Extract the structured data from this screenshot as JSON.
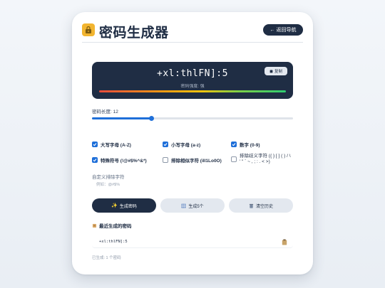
{
  "app": {
    "title": "密码生成器",
    "back_label": "返回导航"
  },
  "display": {
    "password": "+xl:thlFN]:5",
    "strength_label": "密码强度: 强",
    "copy_label": "复制"
  },
  "length": {
    "label": "密码长度: 12",
    "value": 12,
    "min": 4,
    "max": 64
  },
  "options": [
    {
      "label": "大写字母 (A-Z)",
      "checked": true
    },
    {
      "label": "小写字母 (a-z)",
      "checked": true
    },
    {
      "label": "数字 (0-9)",
      "checked": true
    },
    {
      "label": "特殊符号 (!@#$%^&*)",
      "checked": true
    },
    {
      "label": "排除相似字符 (iIl1Lo0O)",
      "checked": false
    },
    {
      "label_line1": "排除歧义字符 ({ } [ ] ( ) / \\",
      "label_line2": "' \" ` ~ , ; : . < >)",
      "checked": false
    }
  ],
  "custom": {
    "label": "自定义排除字符",
    "placeholder": "例如：@#$%"
  },
  "buttons": {
    "generate": "生成密码",
    "generate_five": "生成5个",
    "clear_history": "清空历史"
  },
  "recent": {
    "title": "最近生成的密码",
    "items": [
      "+xl:thlFN]:5"
    ],
    "count_text": "已生成: 1 个密码"
  },
  "colors": {
    "primary": "#1f2d44",
    "accent": "#1e6fd9",
    "secondary_bg": "#e3e8ef",
    "logo": "#f2b530"
  },
  "icons": {
    "logo": "lock-icon",
    "back": "arrow-left-icon",
    "copy": "clipboard-icon",
    "generate": "sparkles-icon",
    "generate_five": "grid-icon",
    "clear": "trash-icon",
    "recent": "scroll-icon"
  }
}
